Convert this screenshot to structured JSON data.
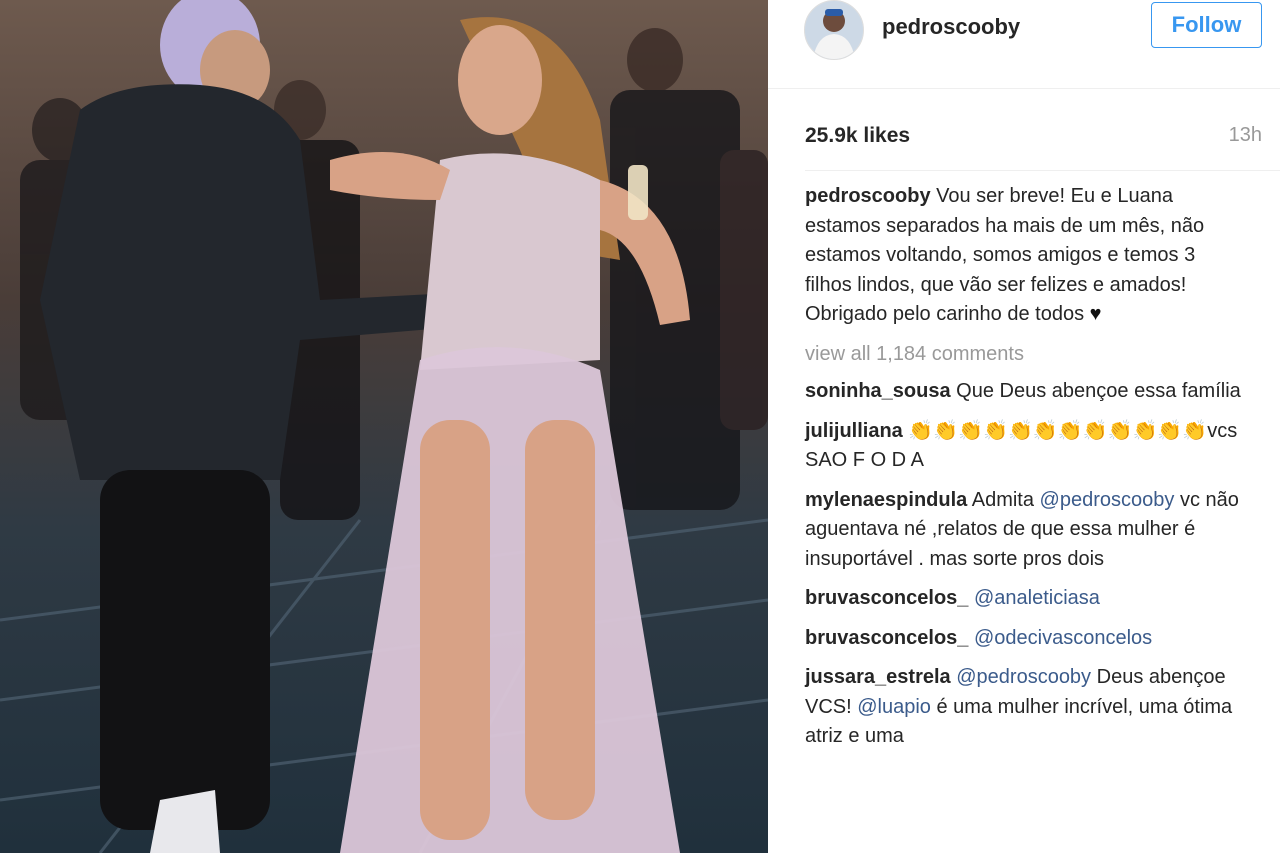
{
  "post": {
    "username": "pedroscooby",
    "follow_label": "Follow",
    "likes": "25.9k likes",
    "timestamp": "13h",
    "caption": {
      "user": "pedroscooby",
      "line1": "Vou ser breve! Eu e Luana estamos separados ha mais de um mês, não estamos voltando, somos amigos e temos 3 filhos lindos, que vão ser felizes e amados!",
      "line2": "Obrigado pelo carinho de todos",
      "heart": "♥"
    },
    "view_all": "view all 1,184 comments",
    "comments": [
      {
        "user": "soninha_sousa",
        "text": "Que Deus abençoe essa família"
      },
      {
        "user": "julijulliana",
        "emoji": "👏👏👏👏👏👏👏👏👏👏👏👏",
        "text": "vcs SAO F O D A"
      },
      {
        "user": "mylenaespindula",
        "pre": "Admita",
        "mention": "@pedroscooby",
        "text": "vc não aguentava né ,relatos de que essa mulher é insuportável . mas sorte pros dois"
      },
      {
        "user": "bruvasconcelos_",
        "mention": "@analeticiasa"
      },
      {
        "user": "bruvasconcelos_",
        "mention": "@odecivasconcelos"
      },
      {
        "user": "jussara_estrela",
        "mention": "@pedroscooby",
        "text": "Deus abençoe VCS!",
        "mention2": "@luapio",
        "text2": "é uma mulher incrível, uma ótima atriz e uma"
      }
    ]
  },
  "colors": {
    "accent": "#3897f0",
    "mention": "#3b5b8b",
    "muted": "#999999"
  },
  "icons": {
    "heart": "heart-icon"
  }
}
